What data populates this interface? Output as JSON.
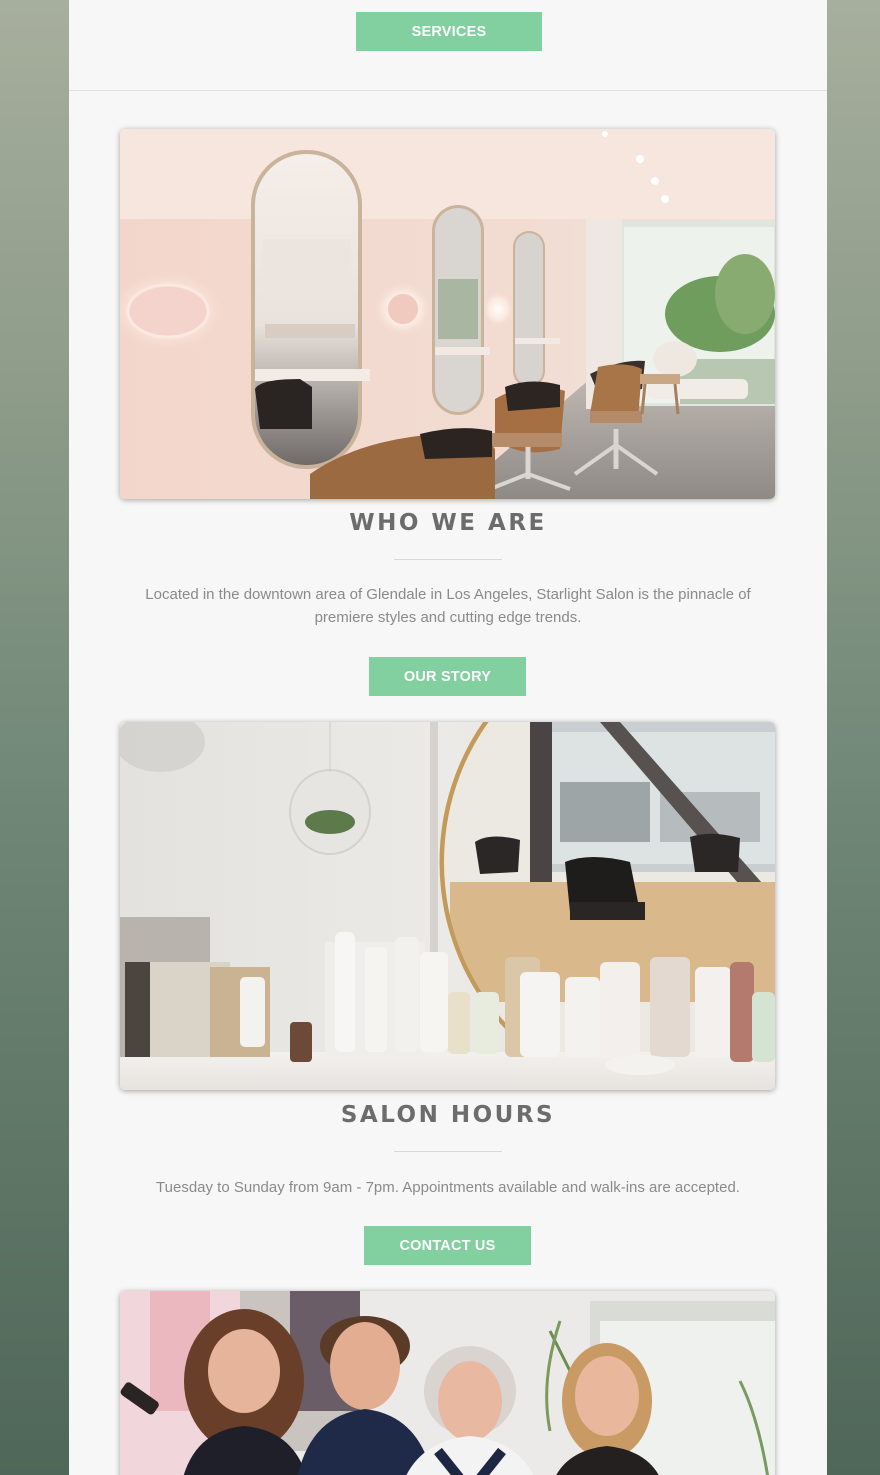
{
  "nav": {
    "services_label": "SERVICES"
  },
  "about": {
    "image_alt": "Salon interior with oval mirrors and styling chairs",
    "heading": "WHO WE ARE",
    "text": "Located in the downtown area of Glendale in Los Angeles, Starlight Salon is the pinnacle of premiere styles and cutting edge trends.",
    "button_label": "OUR STORY"
  },
  "hours": {
    "image_alt": "Salon counter with hair products and round mirror",
    "heading": "SALON HOURS",
    "text": "Tuesday to Sunday from 9am - 7pm. Appointments available and walk-ins are accepted.",
    "button_label": "CONTACT US"
  },
  "team": {
    "image_alt": "Smiling salon team of four stylists"
  },
  "colors": {
    "accent": "#82cfa0",
    "heading": "#6c6c6c",
    "body_text": "#8a8a8a",
    "page_bg": "#f7f7f7"
  }
}
